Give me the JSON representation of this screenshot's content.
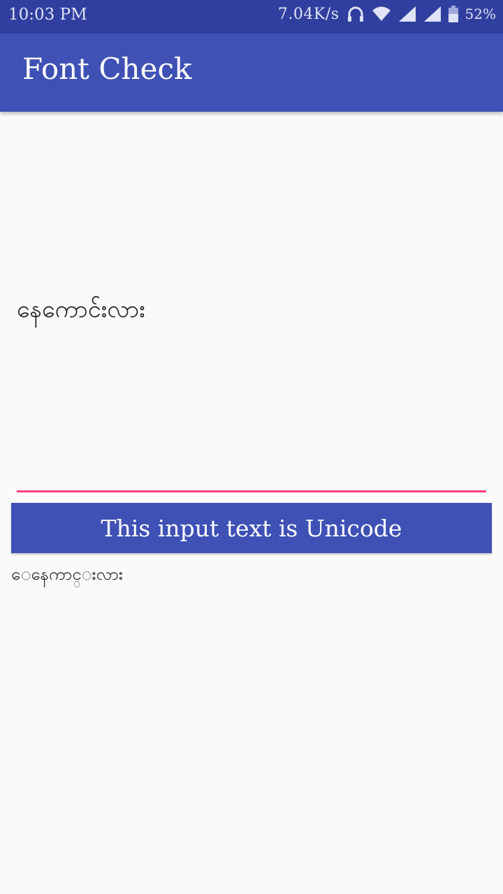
{
  "status_bar": {
    "time": "10:03 PM",
    "network_speed": "7.04K/s",
    "battery": "52%",
    "icons": [
      "headphones-icon",
      "wifi-icon",
      "signal-icon",
      "signal-icon",
      "battery-icon"
    ]
  },
  "app_bar": {
    "title": "Font Check",
    "color": "#3f51b5"
  },
  "main": {
    "display_text": "နေကောင်းလား",
    "input_value": "",
    "button_label": "This input text is Unicode",
    "result_text": "ေနေကာင္းလား",
    "accent_color": "#ff4081"
  }
}
